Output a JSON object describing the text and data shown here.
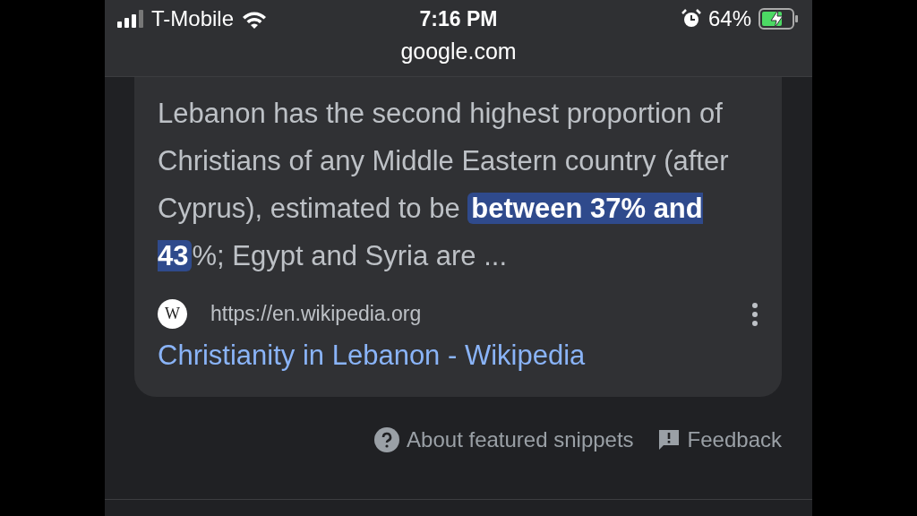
{
  "status_bar": {
    "carrier": "T-Mobile",
    "time": "7:16 PM",
    "battery": "64%"
  },
  "address_bar": {
    "url": "google.com"
  },
  "snippet": {
    "text_before": "Lebanon has the second highest proportion of Christians of any Middle Eastern country (after Cyprus), estimated to be ",
    "highlight": "between 37% and 43",
    "text_after": "%; Egypt and Syria are ...",
    "source_initial": "W",
    "source_url": "https://en.wikipedia.org",
    "title": "Christianity in Lebanon - Wikipedia"
  },
  "footer": {
    "links": [
      "About featured snippets",
      "Feedback"
    ]
  }
}
